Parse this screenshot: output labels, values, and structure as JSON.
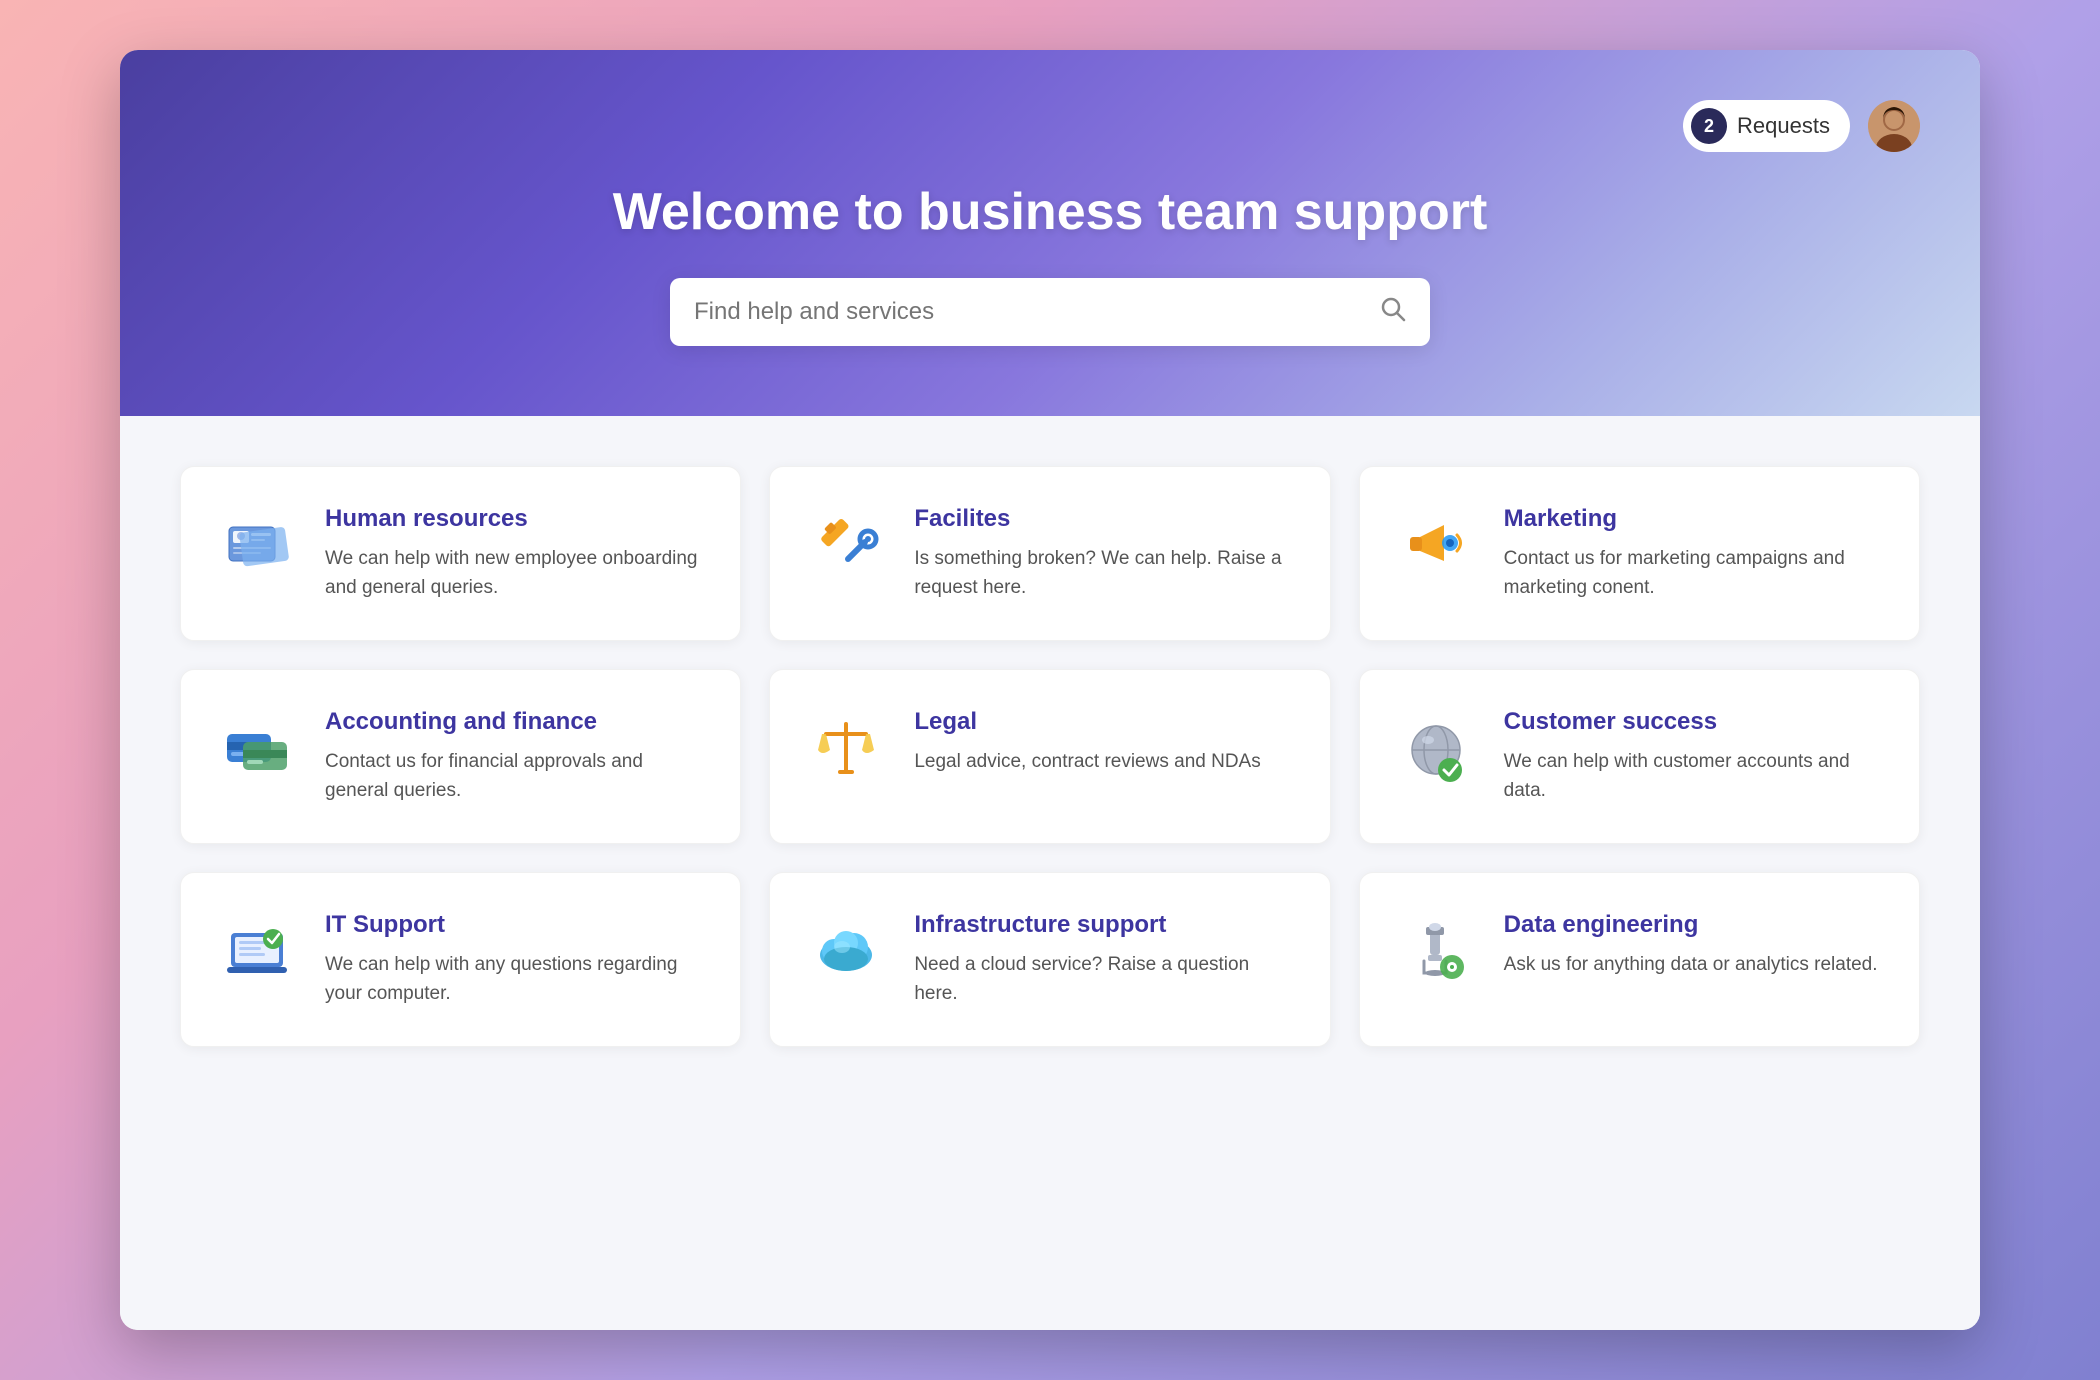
{
  "header": {
    "title": "Welcome to business team support",
    "search_placeholder": "Find help and services",
    "requests_label": "Requests",
    "requests_count": "2"
  },
  "cards": [
    {
      "id": "hr",
      "title": "Human resources",
      "description": "We can help with new employee onboarding and general queries."
    },
    {
      "id": "facilities",
      "title": "Facilites",
      "description": "Is something broken? We can help. Raise a request here."
    },
    {
      "id": "marketing",
      "title": "Marketing",
      "description": "Contact us for marketing campaigns and marketing conent."
    },
    {
      "id": "accounting",
      "title": "Accounting and finance",
      "description": "Contact us for financial approvals and general queries."
    },
    {
      "id": "legal",
      "title": "Legal",
      "description": "Legal advice, contract reviews and NDAs"
    },
    {
      "id": "customer",
      "title": "Customer success",
      "description": "We can help with customer accounts and data."
    },
    {
      "id": "it",
      "title": "IT Support",
      "description": "We can help with any questions regarding your computer."
    },
    {
      "id": "infra",
      "title": "Infrastructure support",
      "description": "Need a cloud service? Raise a question here."
    },
    {
      "id": "data",
      "title": "Data engineering",
      "description": "Ask us for anything data or analytics related."
    }
  ]
}
